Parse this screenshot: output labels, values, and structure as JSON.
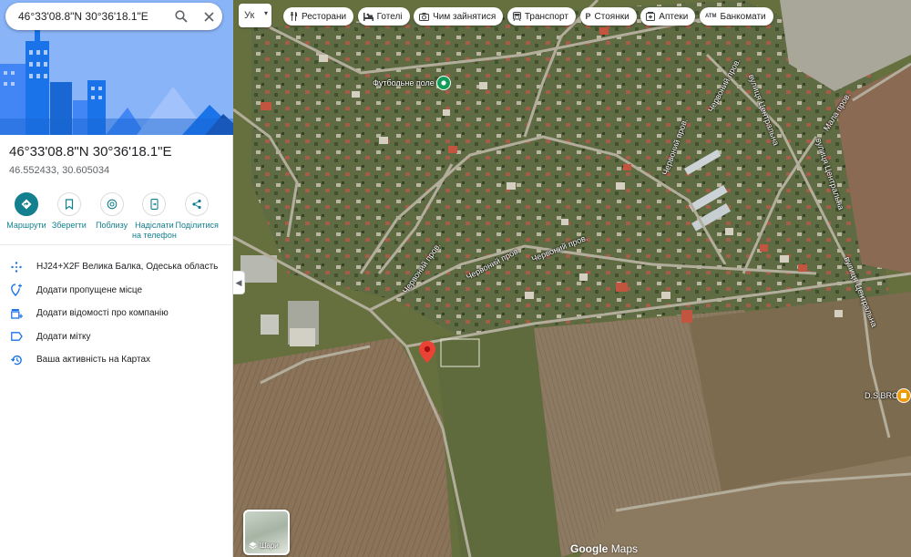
{
  "search": {
    "query": "46°33'08.8\"N 30°36'18.1\"E"
  },
  "place": {
    "title": "46°33'08.8\"N 30°36'18.1\"E",
    "decimal_coords": "46.552433, 30.605034"
  },
  "actions": [
    {
      "label": "Маршрути",
      "icon": "directions-icon"
    },
    {
      "label": "Зберегти",
      "icon": "bookmark-icon"
    },
    {
      "label": "Поблизу",
      "icon": "nearby-icon"
    },
    {
      "label": "Надіслати на телефон",
      "icon": "phone-icon"
    },
    {
      "label": "Поділитися",
      "icon": "share-icon"
    }
  ],
  "info_rows": [
    {
      "text": "HJ24+X2F Велика Балка, Одеська область",
      "icon": "plus-code-icon"
    },
    {
      "text": "Додати пропущене місце",
      "icon": "add-location-icon"
    },
    {
      "text": "Додати відомості про компанію",
      "icon": "add-business-icon"
    },
    {
      "text": "Додати мітку",
      "icon": "label-icon"
    },
    {
      "text": "Ваша активність на Картах",
      "icon": "history-icon"
    }
  ],
  "language_button": "Ук",
  "chips": [
    {
      "label": "Ресторани",
      "icon": "restaurant-icon"
    },
    {
      "label": "Готелі",
      "icon": "hotel-icon"
    },
    {
      "label": "Чим зайнятися",
      "icon": "camera-icon"
    },
    {
      "label": "Транспорт",
      "icon": "transit-icon"
    },
    {
      "label": "Стоянки",
      "icon": "parking-icon"
    },
    {
      "label": "Аптеки",
      "icon": "pharmacy-icon"
    },
    {
      "label": "Банкомати",
      "icon": "atm-icon"
    }
  ],
  "chip_atm_glyph": "ATM",
  "chip_parking_glyph": "P",
  "map_labels": {
    "football_field": "Футбольне поле",
    "chervona_1": "Червоний пров.",
    "chervona_2": "Червоний пров.",
    "chervona_3": "Червоний пров.",
    "chervona_4": "Червоний пров.",
    "chervona_5": "Червоний пров.",
    "chervona_6": "Червоний пров.",
    "tsentralna_1": "вулиця Центральна",
    "tsentralna_2": "вулиця Центральна",
    "mala": "Мала пров.",
    "business": "D.S.BRO"
  },
  "layers_label": "Шари",
  "attribution": {
    "brand": "Google",
    "product": "Maps"
  },
  "colors": {
    "accent": "#137f8f",
    "pin": "#ea4335",
    "poi_green": "#0f9d58",
    "poi_orange": "#f29900"
  }
}
